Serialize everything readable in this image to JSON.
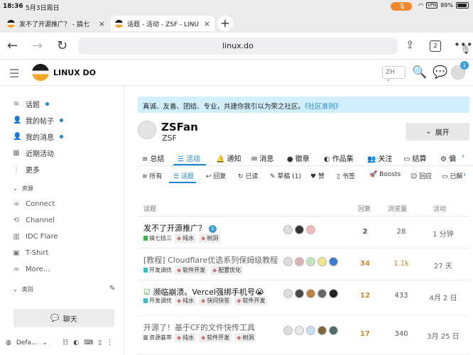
{
  "status": {
    "time": "18:36",
    "date": "5月3日周日",
    "vpn": "VPN",
    "battery": "89%",
    "mic_icon": "mic-icon"
  },
  "tabs": [
    {
      "title": "发不了开源推广？ - 搞七",
      "close": "×"
    },
    {
      "title": "话题 - 活动 - ZSF - LINU",
      "close": "×"
    }
  ],
  "newtab": "+",
  "url": "linux.do",
  "tab_count": "2",
  "site": {
    "name": "LINUX DO",
    "lang": "ZH",
    "notif_count": "1"
  },
  "sidebar": {
    "items": [
      {
        "icon": "layers-icon",
        "label": "话题",
        "dot": true
      },
      {
        "icon": "user-icon",
        "label": "我的帖子",
        "dot": true
      },
      {
        "icon": "user-icon",
        "label": "我的消息",
        "dot": true
      },
      {
        "icon": "calendar-icon",
        "label": "近期活动",
        "dot": false
      },
      {
        "icon": "more-vertical-icon",
        "label": "更多",
        "dot": false
      }
    ],
    "section_resources": "资源",
    "links": [
      {
        "icon": "link-icon",
        "label": "Connect"
      },
      {
        "icon": "channel-icon",
        "label": "Channel"
      },
      {
        "icon": "book-icon",
        "label": "IDC Flare"
      },
      {
        "icon": "shirt-icon",
        "label": "T-Shirt"
      },
      {
        "icon": "infinity-icon",
        "label": "More..."
      }
    ],
    "section_categories": "类别",
    "chat_label": "聊天",
    "footer_label": "Defa..."
  },
  "banner": {
    "text": "真诚、友善、团结、专业，共建你我引以为荣之社区。",
    "link": "《社区准则》"
  },
  "user": {
    "name": "ZSFan",
    "sub": "ZSF",
    "expand_label": "展开"
  },
  "nav_main": [
    {
      "icon": "≡",
      "label": "总结"
    },
    {
      "icon": "☰",
      "label": "活动"
    },
    {
      "icon": "🔔",
      "label": "通知"
    },
    {
      "icon": "✉",
      "label": "消息"
    },
    {
      "icon": "●",
      "label": "徽章"
    },
    {
      "icon": "◐",
      "label": "作品集"
    },
    {
      "icon": "👥",
      "label": "关注"
    },
    {
      "icon": "▭",
      "label": "结算"
    },
    {
      "icon": "⚙",
      "label": "偏"
    }
  ],
  "nav_sub": [
    {
      "icon": "≡",
      "label": "所有"
    },
    {
      "icon": "☰",
      "label": "话题"
    },
    {
      "icon": "↩",
      "label": "回复"
    },
    {
      "icon": "↻",
      "label": "已读"
    },
    {
      "icon": "✎",
      "label": "草稿 (1)"
    },
    {
      "icon": "♥",
      "label": "赞"
    },
    {
      "icon": "▯",
      "label": "书签"
    },
    {
      "icon": "🚀",
      "label": "Boosts"
    },
    {
      "icon": "☺",
      "label": "回应"
    },
    {
      "icon": "▭",
      "label": "已解"
    }
  ],
  "table": {
    "headers": {
      "topic": "话题",
      "replies": "回复",
      "views": "浏览量",
      "activity": "活动"
    },
    "rows": [
      {
        "title": "发不了开源推广？",
        "badge": "1",
        "visited": false,
        "category": "搞七捻三",
        "cat_color": "#3ab54a",
        "tags": [
          "纯水",
          "树洞"
        ],
        "replies": "2",
        "rep_class": "plain",
        "views": "28",
        "activity": "1 分钟",
        "avatar_colors": [
          "#dddddd",
          "#333333",
          "#f2b9b9"
        ]
      },
      {
        "title": "[教程] Cloudflare优选系列保姆级教程",
        "badge": "",
        "visited": true,
        "category": "开发调优",
        "cat_color": "#32c3c3",
        "tags": [
          "软件开发",
          "配置优化"
        ],
        "replies": "34",
        "rep_class": "warm",
        "views": "1.1k",
        "activity": "27 天",
        "avatar_colors": [
          "#dddddd",
          "#d9b3b3",
          "#c4e3c4",
          "#f0e68c",
          "#3a7bd5"
        ]
      },
      {
        "title": "濒临崩溃。Vercel强绑手机号😭",
        "badge": "",
        "visited": false,
        "category": "开发调优",
        "cat_color": "#32c3c3",
        "tags": [
          "纯水",
          "快问快答",
          "软件开发"
        ],
        "replies": "12",
        "rep_class": "warm",
        "views": "433",
        "activity": "4月 2 日",
        "avatar_colors": [
          "#dddddd",
          "#4a4a4a",
          "#c08040",
          "#666666",
          "#222222"
        ]
      },
      {
        "title": "开源了！基于CF的文件快传工具",
        "badge": "",
        "visited": true,
        "category": "资源荟萃",
        "cat_color": "#9e9e9e",
        "tags": [
          "纯水",
          "软件开发",
          "树洞"
        ],
        "replies": "17",
        "rep_class": "warm",
        "views": "340",
        "activity": "3月 25 日",
        "avatar_colors": [
          "#dddddd",
          "#e8e8e8",
          "#c8e0f0",
          "#7a6a3a",
          "#556b6b"
        ]
      }
    ]
  }
}
